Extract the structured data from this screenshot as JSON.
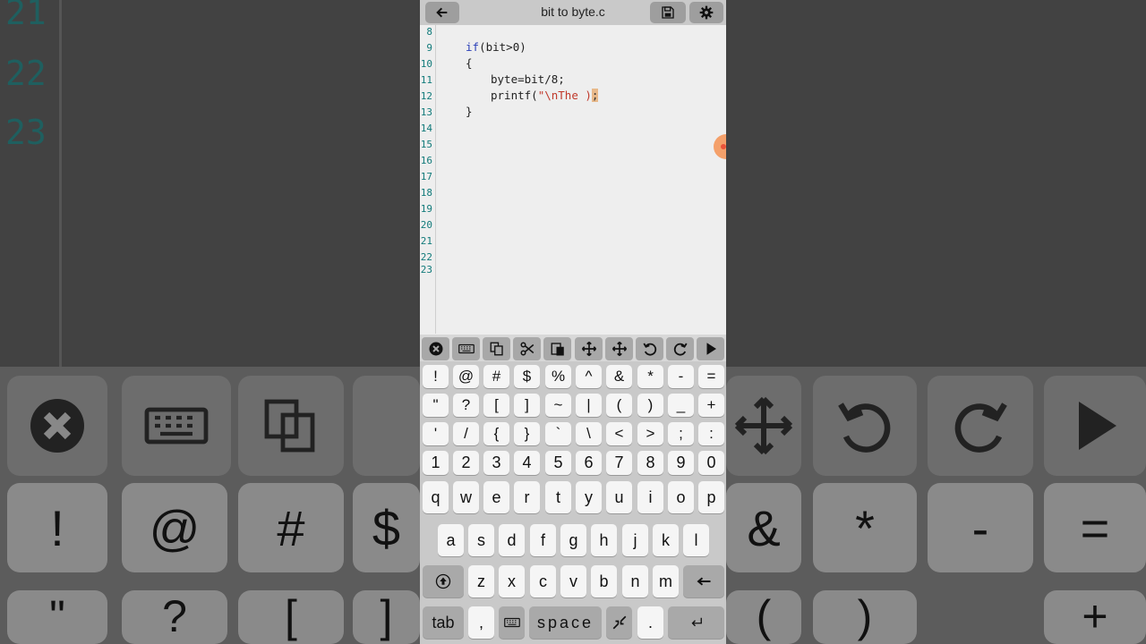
{
  "window": {
    "title": "bit to byte.c"
  },
  "icons": {
    "back": "arrow-left-icon",
    "save": "save-icon",
    "settings": "gear-icon"
  },
  "editor": {
    "line_numbers": [
      "8",
      "9",
      "10",
      "11",
      "12",
      "13",
      "14",
      "15",
      "16",
      "17",
      "18",
      "19",
      "20",
      "21",
      "22",
      "23"
    ],
    "code": {
      "l9_kw": "if",
      "l9_rest": "(bit>0)",
      "l10": "{",
      "l11": "byte=bit/8;",
      "l12_pre": "printf(",
      "l12_str": "\"\\nThe )",
      "l12_end": ";",
      "l13": "}"
    }
  },
  "toolbar": {
    "tools": [
      "close-icon",
      "keyboard-icon",
      "copy-icon",
      "cut-icon",
      "paste-icon",
      "move-icon",
      "move-icon",
      "undo-icon",
      "redo-icon",
      "run-icon"
    ]
  },
  "keyboard": {
    "symbols_row1": [
      "!",
      "@",
      "#",
      "$",
      "%",
      "^",
      "&",
      "*",
      "-",
      "="
    ],
    "symbols_row2": [
      "\"",
      "?",
      "[",
      "]",
      "~",
      "|",
      "(",
      ")",
      "_",
      "+"
    ],
    "symbols_row3": [
      "'",
      "/",
      "{",
      "}",
      "`",
      "\\",
      "<",
      ">",
      ";",
      ":"
    ],
    "numbers": [
      "1",
      "2",
      "3",
      "4",
      "5",
      "6",
      "7",
      "8",
      "9",
      "0"
    ],
    "letters_row1": [
      "q",
      "w",
      "e",
      "r",
      "t",
      "y",
      "u",
      "i",
      "o",
      "p"
    ],
    "letters_row2": [
      "a",
      "s",
      "d",
      "f",
      "g",
      "h",
      "j",
      "k",
      "l"
    ],
    "letters_row3": [
      "z",
      "x",
      "c",
      "v",
      "b",
      "n",
      "m"
    ],
    "tab_label": "tab",
    "comma_label": ",",
    "space_label": "space",
    "period_label": "."
  },
  "background": {
    "line_numbers": [
      "21",
      "22",
      "23"
    ],
    "symbols": [
      "!",
      "@",
      "#",
      "$",
      "&",
      "*",
      "-",
      "=",
      "\"",
      "?",
      "[",
      "]",
      "(",
      ")",
      "+"
    ]
  },
  "colors": {
    "keyword": "#2a3fb8",
    "string": "#c0392b",
    "line_number": "#117a7a",
    "highlight": "#e8b98a"
  }
}
